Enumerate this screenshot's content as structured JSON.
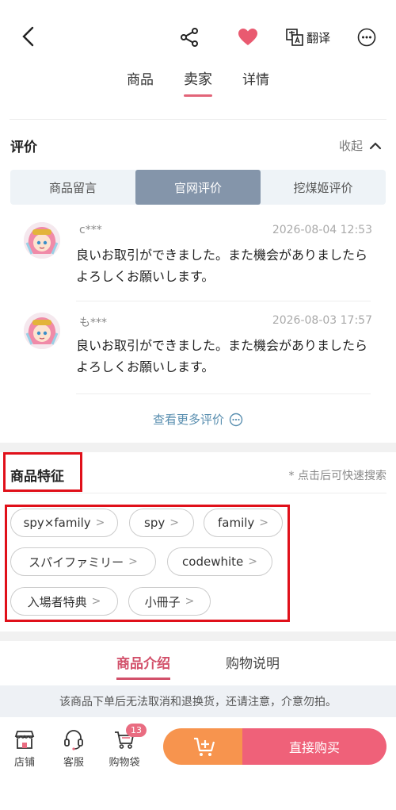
{
  "header": {
    "translate_label": "翻译",
    "tabs": [
      {
        "label": "商品"
      },
      {
        "label": "卖家"
      },
      {
        "label": "详情"
      }
    ]
  },
  "reviews": {
    "title": "评价",
    "collapse_label": "收起",
    "segments": [
      "商品留言",
      "官网评价",
      "挖煤姬评价"
    ],
    "items": [
      {
        "name": "c***",
        "date": "2026-08-04 12:53",
        "text": "良いお取引ができました。また機会がありましたらよろしくお願いします。"
      },
      {
        "name": "も***",
        "date": "2026-08-03 17:57",
        "text": "良いお取引ができました。また機会がありましたらよろしくお願いします。"
      }
    ],
    "more_label": "查看更多评价"
  },
  "features": {
    "title": "商品特征",
    "hint": "* 点击后可快速搜索",
    "tags": [
      "spy×family",
      "spy",
      "family",
      "スパイファミリー",
      "codewhite",
      "入場者特典",
      "小冊子"
    ]
  },
  "intro": {
    "tabs": [
      "商品介绍",
      "购物说明"
    ],
    "notice": "该商品下单后无法取消和退换货，还请注意，介意勿拍。"
  },
  "bottombar": {
    "shop_label": "店铺",
    "service_label": "客服",
    "cart_label": "购物袋",
    "cart_badge": "13",
    "buy_label": "直接购买"
  },
  "colors": {
    "accent": "#e26478",
    "buy": "#ef6179",
    "cart": "#f7944e",
    "segment_active": "#8495aa"
  }
}
